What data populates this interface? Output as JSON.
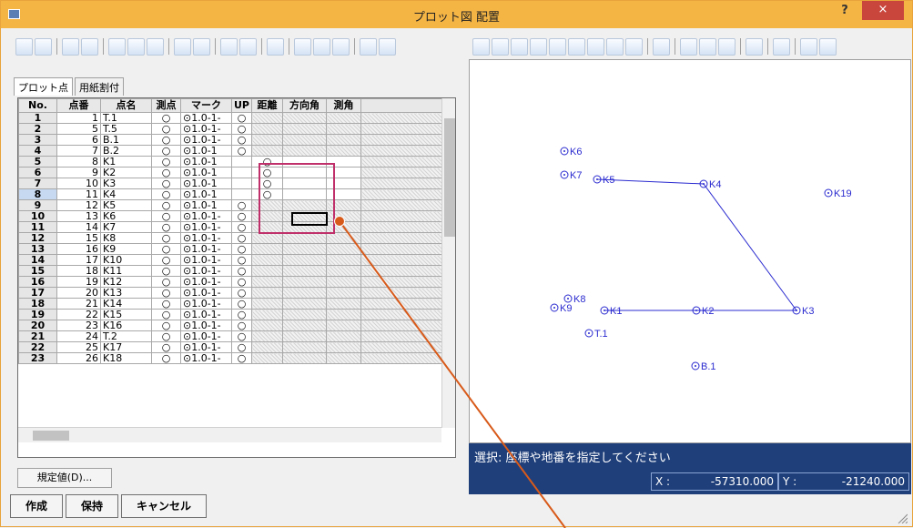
{
  "window": {
    "title": "プロット図 配置",
    "help": "?",
    "close": "×"
  },
  "tabs": [
    "プロット点",
    "用紙割付"
  ],
  "grid": {
    "headers": [
      "No.",
      "点番",
      "点名",
      "測点",
      "マーク",
      "UP",
      "距離",
      "方向角",
      "測角"
    ],
    "rows": [
      [
        "1",
        "1",
        "T.1",
        "○",
        "⊙1.0-1-",
        "○",
        "",
        "",
        ""
      ],
      [
        "2",
        "5",
        "T.5",
        "○",
        "⊙1.0-1-",
        "○",
        "",
        "",
        ""
      ],
      [
        "3",
        "6",
        "B.1",
        "○",
        "⊙1.0-1-",
        "○",
        "",
        "",
        ""
      ],
      [
        "4",
        "7",
        "B.2",
        "○",
        "⊙1.0-1",
        "○",
        "",
        "",
        ""
      ],
      [
        "5",
        "8",
        "K1",
        "○",
        "⊙1.0-1",
        "",
        "○",
        "",
        ""
      ],
      [
        "6",
        "9",
        "K2",
        "○",
        "⊙1.0-1",
        "",
        "○",
        "",
        ""
      ],
      [
        "7",
        "10",
        "K3",
        "○",
        "⊙1.0-1",
        "",
        "○",
        "",
        ""
      ],
      [
        "8",
        "11",
        "K4",
        "○",
        "⊙1.0-1",
        "",
        "○",
        "",
        ""
      ],
      [
        "9",
        "12",
        "K5",
        "○",
        "⊙1.0-1",
        "○",
        "",
        "",
        ""
      ],
      [
        "10",
        "13",
        "K6",
        "○",
        "⊙1.0-1-",
        "○",
        "",
        "",
        ""
      ],
      [
        "11",
        "14",
        "K7",
        "○",
        "⊙1.0-1-",
        "○",
        "",
        "",
        ""
      ],
      [
        "12",
        "15",
        "K8",
        "○",
        "⊙1.0-1-",
        "○",
        "",
        "",
        ""
      ],
      [
        "13",
        "16",
        "K9",
        "○",
        "⊙1.0-1-",
        "○",
        "",
        "",
        ""
      ],
      [
        "14",
        "17",
        "K10",
        "○",
        "⊙1.0-1-",
        "○",
        "",
        "",
        ""
      ],
      [
        "15",
        "18",
        "K11",
        "○",
        "⊙1.0-1-",
        "○",
        "",
        "",
        ""
      ],
      [
        "16",
        "19",
        "K12",
        "○",
        "⊙1.0-1-",
        "○",
        "",
        "",
        ""
      ],
      [
        "17",
        "20",
        "K13",
        "○",
        "⊙1.0-1-",
        "○",
        "",
        "",
        ""
      ],
      [
        "18",
        "21",
        "K14",
        "○",
        "⊙1.0-1-",
        "○",
        "",
        "",
        ""
      ],
      [
        "19",
        "22",
        "K15",
        "○",
        "⊙1.0-1-",
        "○",
        "",
        "",
        ""
      ],
      [
        "20",
        "23",
        "K16",
        "○",
        "⊙1.0-1-",
        "○",
        "",
        "",
        ""
      ],
      [
        "21",
        "24",
        "T.2",
        "○",
        "⊙1.0-1-",
        "○",
        "",
        "",
        ""
      ],
      [
        "22",
        "25",
        "K17",
        "○",
        "⊙1.0-1-",
        "○",
        "",
        "",
        ""
      ],
      [
        "23",
        "26",
        "K18",
        "○",
        "⊙1.0-1-",
        "○",
        "",
        "",
        ""
      ]
    ],
    "selected_row": "8"
  },
  "buttons": {
    "default": "規定値(D)...",
    "create": "作成",
    "hold": "保持",
    "cancel": "キャンセル"
  },
  "status": {
    "message": "選択: 座標や地番を指定してください",
    "x_label": "X :",
    "x_value": "-57310.000",
    "y_label": "Y :",
    "y_value": "-21240.000"
  },
  "plot_points": [
    "K6",
    "K7",
    "K5",
    "K4",
    "K19",
    "K8",
    "K9",
    "K1",
    "K2",
    "K3",
    "T.1",
    "B.1"
  ],
  "colors": {
    "titlebar": "#f5b545",
    "plot": "#2a2ad0",
    "highlight": "#c0306a",
    "status_bg": "#1f3f7a"
  }
}
